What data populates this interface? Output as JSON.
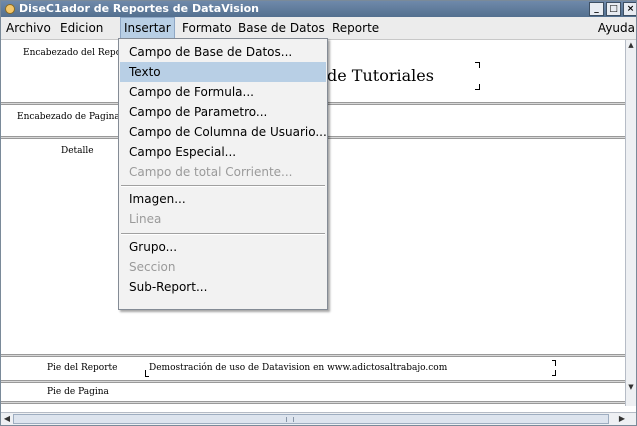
{
  "window": {
    "title": "DiseC1ador de Reportes de DataVision",
    "controls": [
      "_",
      "□",
      "×"
    ]
  },
  "menubar": {
    "items": [
      {
        "label": "Archivo",
        "active": false
      },
      {
        "label": "Edicion",
        "active": false
      },
      {
        "label": "Insertar",
        "active": true
      },
      {
        "label": "Formato",
        "active": false
      },
      {
        "label": "Base de Datos",
        "active": false
      },
      {
        "label": "Reporte",
        "active": false
      }
    ],
    "help": "Ayuda"
  },
  "report": {
    "bands": [
      {
        "label": "Encabezado del Reporte",
        "content": "de Tutoriales"
      },
      {
        "label": "Encabezado de Pagina",
        "content": ""
      },
      {
        "label": "Detalle",
        "content": ""
      },
      {
        "label": "Pie del Reporte",
        "content": "Demostración de uso de Datavision en www.adictosaltrabajo.com"
      },
      {
        "label": "Pie de Pagina",
        "content": ""
      }
    ]
  },
  "insert_menu": {
    "items": [
      {
        "label": "Campo de Base de Datos...",
        "enabled": true,
        "highlighted": false
      },
      {
        "label": "Texto",
        "enabled": true,
        "highlighted": true
      },
      {
        "label": "Campo de Formula...",
        "enabled": true,
        "highlighted": false
      },
      {
        "label": "Campo de Parametro...",
        "enabled": true,
        "highlighted": false
      },
      {
        "label": "Campo de Columna de Usuario...",
        "enabled": true,
        "highlighted": false
      },
      {
        "label": "Campo Especial...",
        "enabled": true,
        "highlighted": false
      },
      {
        "label": "Campo de total Corriente...",
        "enabled": false,
        "highlighted": false
      },
      {
        "label": "Imagen...",
        "enabled": true,
        "highlighted": false
      },
      {
        "label": "Linea",
        "enabled": false,
        "highlighted": false
      },
      {
        "label": "Grupo...",
        "enabled": true,
        "highlighted": false
      },
      {
        "label": "Seccion",
        "enabled": false,
        "highlighted": false
      },
      {
        "label": "Sub-Report...",
        "enabled": true,
        "highlighted": false
      }
    ]
  },
  "colors": {
    "title_bar": "#5f7b9c",
    "menu_highlight": "#b8cfe5",
    "disabled_text": "#9a9a9a"
  }
}
